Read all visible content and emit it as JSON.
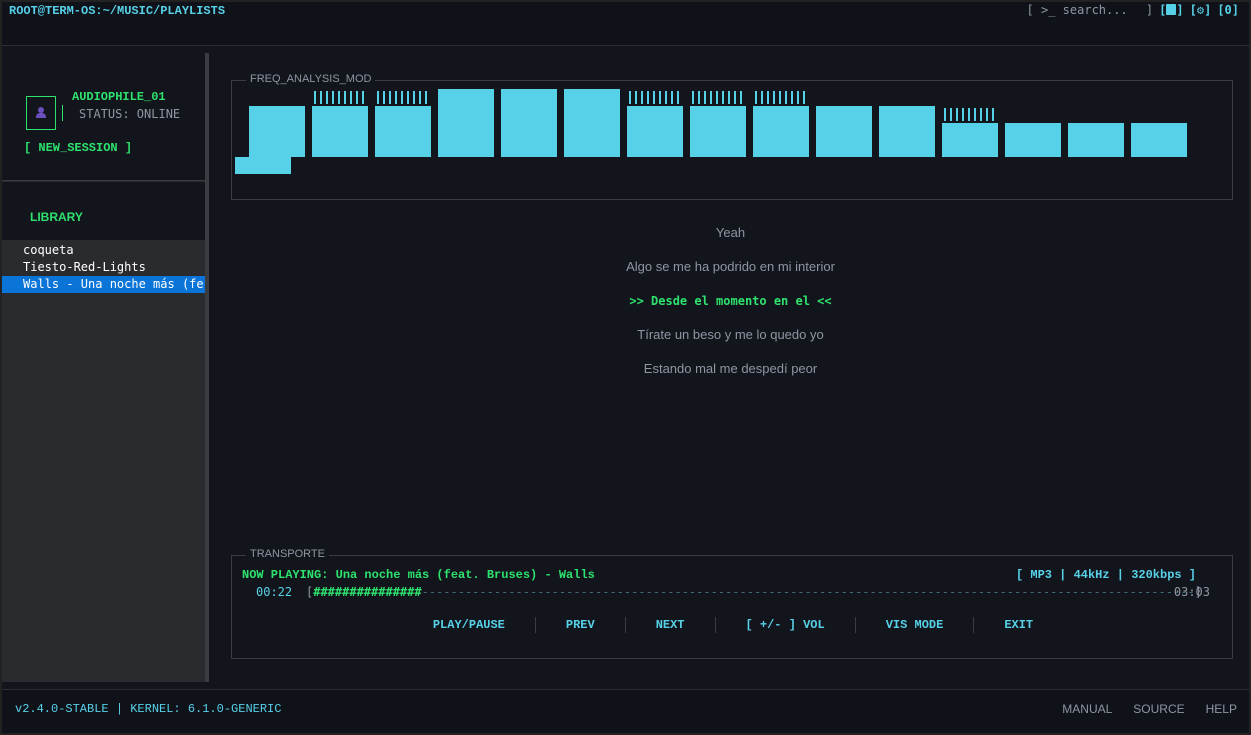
{
  "header": {
    "path": "ROOT@TERM-OS:~/MUSIC/PLAYLISTS",
    "search_prefix": "[ >_",
    "search_placeholder": "search...",
    "search_suffix": "]",
    "btn_file": "[",
    "btn_file_end": "]",
    "btn_settings": "[",
    "btn_settings_end": "]",
    "btn_count": "[0]"
  },
  "sidebar": {
    "username": "AUDIOPHILE_01",
    "status": "STATUS: ONLINE",
    "new_session": "[ NEW_SESSION ]",
    "library_title": "LIBRARY",
    "items": [
      {
        "label": "coqueta"
      },
      {
        "label": "Tiesto-Red-Lights"
      },
      {
        "label": "Walls - Una noche más (fe"
      }
    ]
  },
  "visualizer": {
    "title": "FREQ_ANALYSIS_MOD",
    "color": "#57d1e8"
  },
  "lyrics": {
    "lines": [
      "Yeah",
      "Algo se me ha podrido en mi interior",
      ">> Desde el momento en el  <<",
      "Tírate un beso y me lo quedo yo",
      "Estando mal me despedí peor"
    ]
  },
  "transport": {
    "title": "TRANSPORTE",
    "now_playing": "NOW PLAYING: Una noche más (feat. Bruses) - Walls",
    "format": "[ MP3 | 44kHz | 320kbps ]",
    "elapsed": "00:22",
    "duration": "03:03",
    "progress_open": "[",
    "progress_fill": "###############",
    "progress_rest": "-----------------------------------------------------------------------------------------------------------",
    "progress_close": "]",
    "progress_fraction": 0.12,
    "controls": {
      "play_pause": "PLAY/PAUSE",
      "prev": "PREV",
      "next": "NEXT",
      "vol": "[ +/- ] VOL",
      "vis_mode": "VIS MODE",
      "exit": "EXIT"
    }
  },
  "footer": {
    "version": "v2.4.0-STABLE | KERNEL: 6.1.0-GENERIC",
    "manual": "MANUAL",
    "source": "SOURCE",
    "help": "HELP"
  }
}
